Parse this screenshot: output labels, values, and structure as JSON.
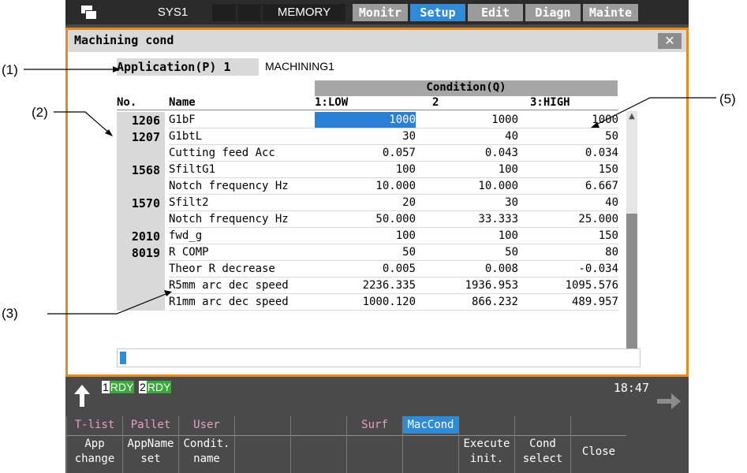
{
  "annotations": [
    "(1)",
    "(2)",
    "(3)",
    "(5)"
  ],
  "topbar": {
    "system": "SYS1",
    "mode": "MEMORY",
    "menus": [
      "Monitr",
      "Setup",
      "Edit",
      "Diagn",
      "Mainte"
    ],
    "active_menu": "Setup"
  },
  "window": {
    "title": "Machining cond",
    "close_glyph": "✕",
    "application_label": "Application(P) 1",
    "application_value": "MACHINING1",
    "condition_header": "Condition(Q)",
    "col_no": "No.",
    "col_name": "Name",
    "col1": "1:LOW",
    "col2": "2",
    "col3": "3:HIGH",
    "rows": [
      {
        "no": "1206",
        "name": "G1bF",
        "v1": "1000",
        "v2": "1000",
        "v3": "1000"
      },
      {
        "no": "1207",
        "name": "G1btL",
        "v1": "30",
        "v2": "40",
        "v3": "50"
      },
      {
        "no": "",
        "name": "Cutting feed Acc",
        "v1": "0.057",
        "v2": "0.043",
        "v3": "0.034"
      },
      {
        "no": "1568",
        "name": "SfiltG1",
        "v1": "100",
        "v2": "100",
        "v3": "150"
      },
      {
        "no": "",
        "name": "Notch frequency Hz",
        "v1": "10.000",
        "v2": "10.000",
        "v3": "6.667"
      },
      {
        "no": "1570",
        "name": "Sfilt2",
        "v1": "20",
        "v2": "30",
        "v3": "40"
      },
      {
        "no": "",
        "name": "Notch frequency Hz",
        "v1": "50.000",
        "v2": "33.333",
        "v3": "25.000"
      },
      {
        "no": "2010",
        "name": "fwd_g",
        "v1": "100",
        "v2": "100",
        "v3": "150"
      },
      {
        "no": "8019",
        "name": "R COMP",
        "v1": "50",
        "v2": "50",
        "v3": "80"
      },
      {
        "no": "",
        "name": "Theor R decrease",
        "v1": "0.005",
        "v2": "0.008",
        "v3": "-0.034"
      },
      {
        "no": "",
        "name": "R5mm arc dec speed",
        "v1": "2236.335",
        "v2": "1936.953",
        "v3": "1095.576"
      },
      {
        "no": "",
        "name": "R1mm arc dec speed",
        "v1": "1000.120",
        "v2": "866.232",
        "v3": "489.957"
      }
    ]
  },
  "status": {
    "rdy1_num": "1",
    "rdy1_txt": "RDY",
    "rdy2_num": "2",
    "rdy2_txt": "RDY",
    "time": "18:47"
  },
  "softkeys": [
    {
      "top": "T-list",
      "bottom": [
        "App",
        "change"
      ]
    },
    {
      "top": "Pallet",
      "bottom": [
        "AppName",
        "set"
      ]
    },
    {
      "top": "User",
      "bottom": [
        "Condit.",
        "name"
      ]
    },
    {
      "top": "",
      "bottom": [
        "",
        ""
      ]
    },
    {
      "top": "",
      "bottom": [
        "",
        ""
      ]
    },
    {
      "top": "Surf",
      "bottom": [
        "",
        ""
      ]
    },
    {
      "top": "MacCond",
      "bottom": [
        "",
        ""
      ],
      "active": true
    },
    {
      "top": "",
      "bottom": [
        "Execute",
        "init."
      ]
    },
    {
      "top": "",
      "bottom": [
        "Cond",
        "select"
      ]
    },
    {
      "top": "",
      "bottom": [
        "Close",
        ""
      ]
    }
  ],
  "colors": {
    "active_tab": "#2f8ad8",
    "window_border": "#e98a1f",
    "rdy_green": "#3aa83a",
    "softkey_top_text": "#e7a0c0"
  },
  "icons": [
    "return-arrow-icon",
    "forward-arrow-icon",
    "close-icon",
    "scroll-up-icon",
    "scroll-down-icon"
  ]
}
